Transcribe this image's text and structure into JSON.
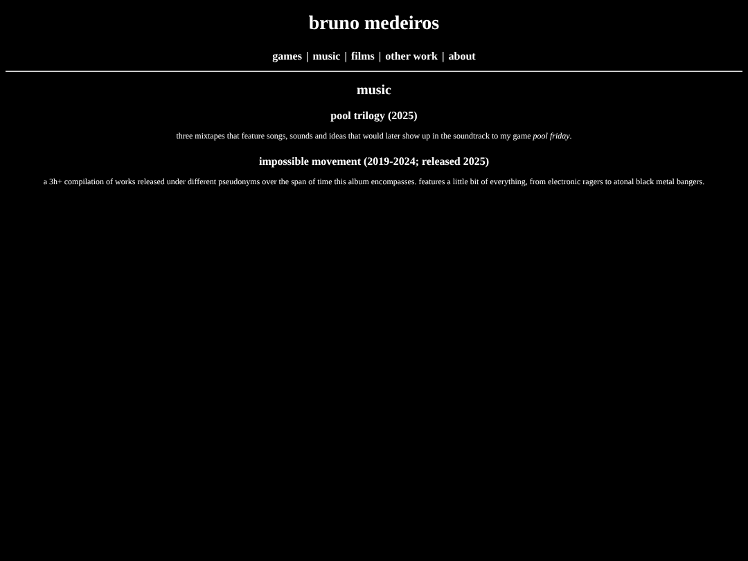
{
  "site_title": "bruno medeiros",
  "nav": {
    "separator": "|",
    "items": [
      {
        "label": "games"
      },
      {
        "label": "music"
      },
      {
        "label": "films"
      },
      {
        "label": "other work"
      },
      {
        "label": "about"
      }
    ]
  },
  "page_heading": "music",
  "sections": [
    {
      "title": "pool trilogy (2025)",
      "description": "three mixtapes that feature songs, sounds and ideas that would later show up in the soundtrack to my game *pool friday*."
    },
    {
      "title": "impossible movement (2019-2024; released 2025)",
      "description": "a 3h+ compilation of works released under different pseudonyms over the span of time this album encompasses. features a little bit of everything, from electronic ragers to atonal black metal bangers."
    }
  ]
}
